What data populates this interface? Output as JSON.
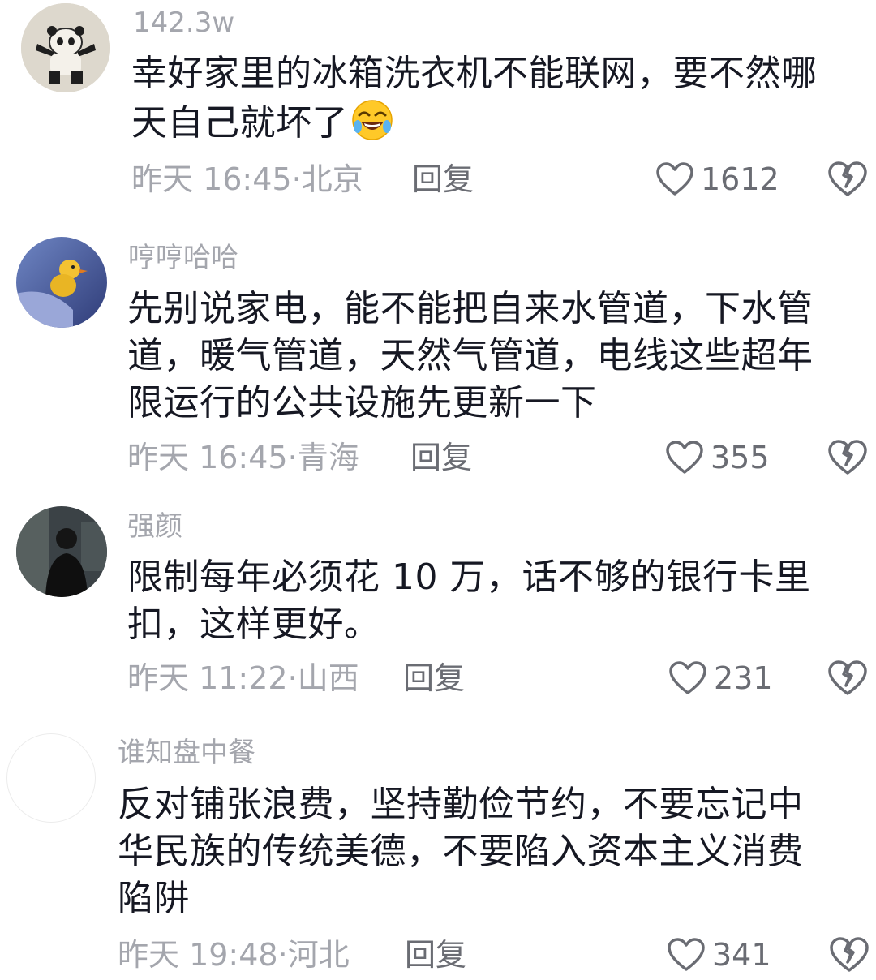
{
  "comments": [
    {
      "username": "142.3w",
      "content_lines": [
        "幸好家里的冰箱洗衣机不能联网，要不然哪",
        "天自己就坏了"
      ],
      "emoji": "rolling-on-floor-laughing-emoji",
      "time": "昨天 16:45",
      "separator": "·",
      "location": "北京",
      "reply_label": "回复",
      "likes": "1612"
    },
    {
      "username": "哼哼哈哈",
      "content_lines": [
        "先别说家电，能不能把自来水管道，下水管",
        "道，暖气管道，天然气管道，电线这些超年",
        "限运行的公共设施先更新一下"
      ],
      "time": "昨天 16:45",
      "separator": "·",
      "location": "青海",
      "reply_label": "回复",
      "likes": "355"
    },
    {
      "username": "强颜",
      "content_lines": [
        "限制每年必须花 10 万，话不够的银行卡里",
        "扣，这样更好。"
      ],
      "time": "昨天 11:22",
      "separator": "·",
      "location": "山西",
      "reply_label": "回复",
      "likes": "231"
    },
    {
      "username": "谁知盘中餐",
      "content_lines": [
        "反对铺张浪费，坚持勤俭节约，不要忘记中",
        "华民族的传统美德，不要陷入资本主义消费",
        "陷阱"
      ],
      "time": "昨天 19:48",
      "separator": "·",
      "location": "河北",
      "reply_label": "回复",
      "likes": "341"
    }
  ],
  "icons": {
    "like": "heart-outline-icon",
    "dislike": "broken-heart-icon"
  },
  "colors": {
    "meta_gray": "#a4a6ad",
    "text": "#161823",
    "action_gray": "#6a6c73"
  }
}
